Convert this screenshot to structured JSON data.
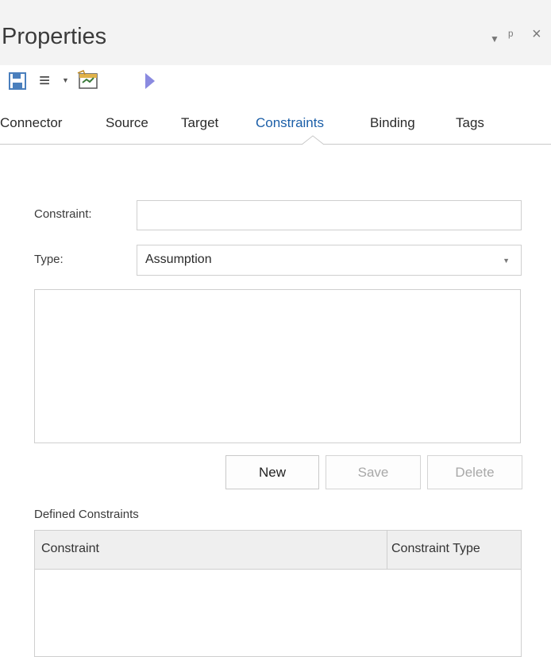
{
  "window": {
    "title": "Properties",
    "controls": {
      "dropdown": "▾",
      "pin": "ᵖ",
      "close": "×"
    }
  },
  "toolbar": {
    "icons": [
      "save-icon",
      "menu-icon",
      "properties-icon",
      "play-icon"
    ],
    "menu_caret": "▾"
  },
  "tabs": {
    "items": [
      {
        "label": "Connector"
      },
      {
        "label": "Source"
      },
      {
        "label": "Target"
      },
      {
        "label": "Constraints",
        "active": true
      },
      {
        "label": "Binding"
      },
      {
        "label": "Tags"
      }
    ]
  },
  "form": {
    "constraint_label": "Constraint:",
    "constraint_value": "",
    "type_label": "Type:",
    "type_value": "Assumption",
    "notes_value": ""
  },
  "buttons": {
    "new": "New",
    "save": "Save",
    "delete": "Delete"
  },
  "defined": {
    "section_label": "Defined Constraints",
    "columns": [
      "Constraint",
      "Constraint Type"
    ],
    "rows": []
  },
  "colors": {
    "active_tab": "#1c5fa8",
    "save_icon": "#4a7fbd",
    "play_icon": "#8a8ae0"
  }
}
